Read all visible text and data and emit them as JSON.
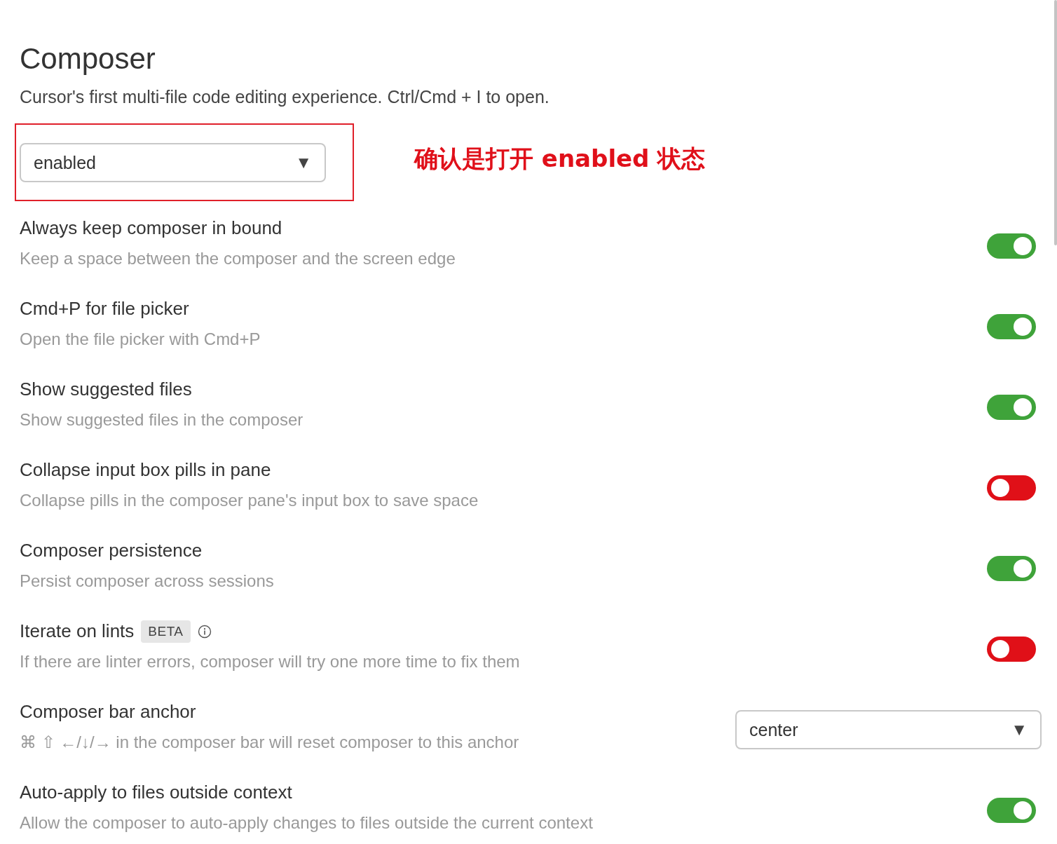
{
  "title": "Composer",
  "subtitle": "Cursor's first multi-file code editing experience. Ctrl/Cmd + I to open.",
  "mode_select": {
    "value": "enabled",
    "caret": "▼"
  },
  "annotation": "确认是打开 enabled 状态",
  "settings": [
    {
      "kind": "toggle",
      "title": "Always keep composer in bound",
      "description": "Keep a space between the composer and the screen edge",
      "on": true
    },
    {
      "kind": "toggle",
      "title": "Cmd+P for file picker",
      "description": "Open the file picker with Cmd+P",
      "on": true
    },
    {
      "kind": "toggle",
      "title": "Show suggested files",
      "description": "Show suggested files in the composer",
      "on": true
    },
    {
      "kind": "toggle",
      "title": "Collapse input box pills in pane",
      "description": "Collapse pills in the composer pane's input box to save space",
      "on": false
    },
    {
      "kind": "toggle",
      "title": "Composer persistence",
      "description": "Persist composer across sessions",
      "on": true
    },
    {
      "kind": "toggle",
      "title": "Iterate on lints",
      "badge": "BETA",
      "info": true,
      "description": "If there are linter errors, composer will try one more time to fix them",
      "on": false
    },
    {
      "kind": "select",
      "title": "Composer bar anchor",
      "description": "⌘ ⇧ ←/↓/→ in the composer bar will reset composer to this anchor",
      "value": "center",
      "caret": "▼"
    },
    {
      "kind": "toggle",
      "title": "Auto-apply to files outside context",
      "description": "Allow the composer to auto-apply changes to files outside the current context",
      "on": true
    }
  ]
}
